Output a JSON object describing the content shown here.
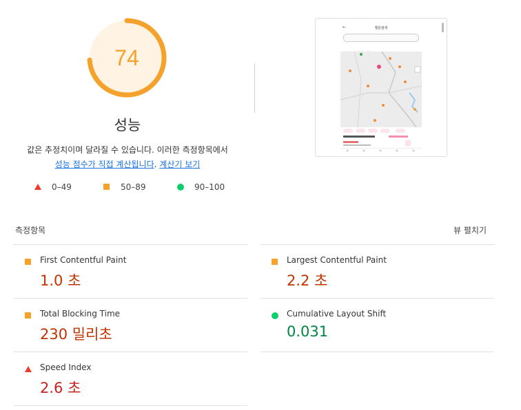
{
  "gauge": {
    "score": "74",
    "fraction": 0.74,
    "color": "#f4a22b",
    "track": "#fff3e3"
  },
  "category": {
    "title": "성능"
  },
  "description": {
    "line1": "값은 추정치이며 달라질 수 있습니다. 이러한 측정항목에서",
    "link1": "성능 점수가 직접 계산됩니다",
    "sep": ".",
    "link2": "계산기 보기"
  },
  "legend": [
    {
      "shape": "triangle",
      "label": "0–49",
      "color": "#eb3a2e"
    },
    {
      "shape": "square",
      "label": "50–89",
      "color": "#f4a22b"
    },
    {
      "shape": "circle",
      "label": "90–100",
      "color": "#0cce6b"
    }
  ],
  "screenshot": {
    "title": "행운검색",
    "search_placeholder": ""
  },
  "metrics_section": {
    "title": "측정항목",
    "toggle": "뷰 펼치기"
  },
  "metrics": [
    {
      "name": "First Contentful Paint",
      "value": "1.0 초",
      "rating": "average"
    },
    {
      "name": "Largest Contentful Paint",
      "value": "2.2 초",
      "rating": "average"
    },
    {
      "name": "Total Blocking Time",
      "value": "230 밀리초",
      "rating": "average"
    },
    {
      "name": "Cumulative Layout Shift",
      "value": "0.031",
      "rating": "pass"
    },
    {
      "name": "Speed Index",
      "value": "2.6 초",
      "rating": "fail"
    }
  ]
}
